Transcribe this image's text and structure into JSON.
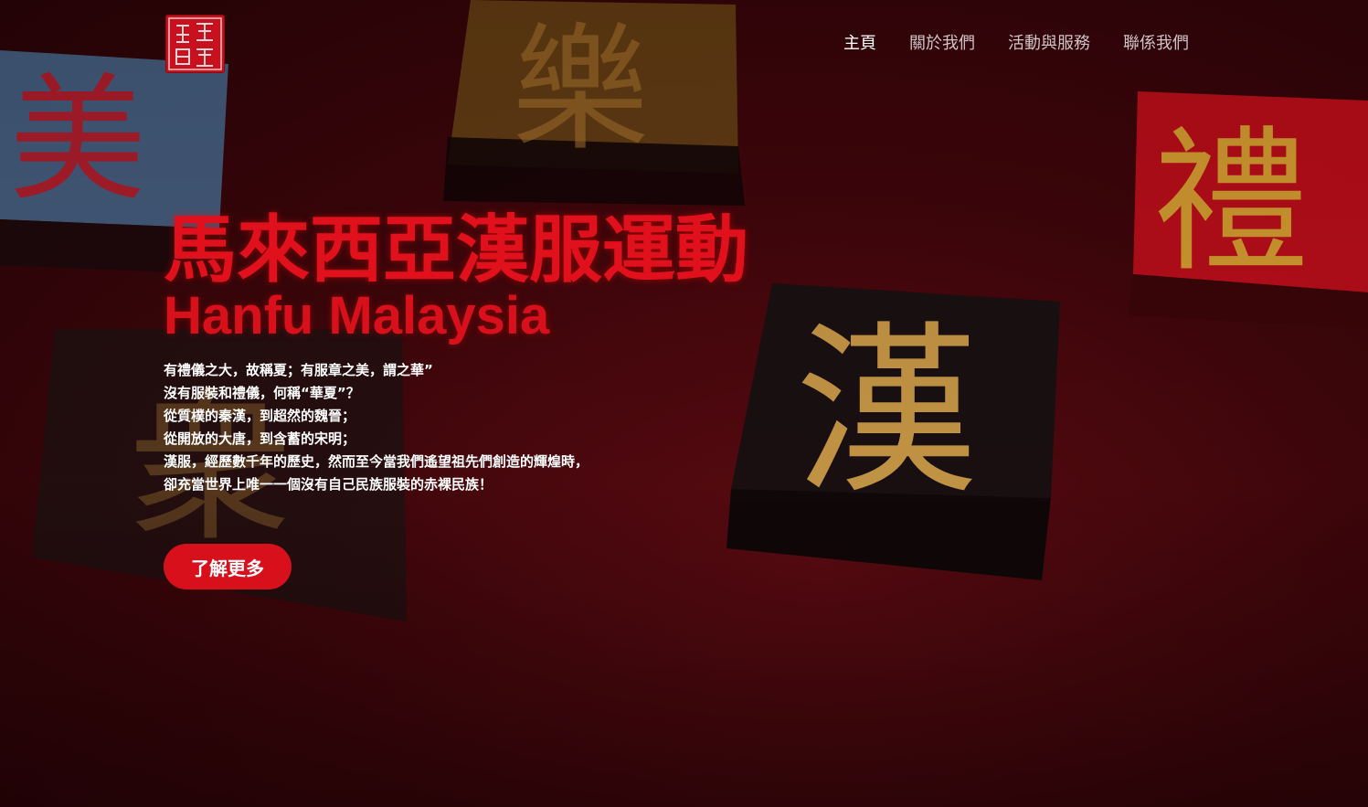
{
  "header": {
    "logo": {
      "icon": "hanfu-seal-logo-icon",
      "color": "#c8101e"
    },
    "nav": [
      {
        "label": "主頁",
        "active": true
      },
      {
        "label": "關於我們",
        "active": false
      },
      {
        "label": "活動與服務",
        "active": false
      },
      {
        "label": "聯係我們",
        "active": false
      }
    ]
  },
  "hero": {
    "background_tiles": [
      "美",
      "樂",
      "禮",
      "漢",
      "衆"
    ],
    "title_zh": "馬來西亞漢服運動",
    "title_en": "Hanfu Malaysia",
    "poem": [
      "有禮儀之大，故稱夏；有服章之美，謂之華”",
      "沒有服裝和禮儀，何稱“華夏”？",
      "從質樸的秦漢，到超然的魏晉；",
      "從開放的大唐，到含蓄的宋明；",
      "漢服，經歷數千年的歷史，然而至今當我們遙望祖先們創造的輝煌時，",
      "卻充當世界上唯一一個沒有自己民族服裝的赤裸民族！"
    ],
    "cta_label": "了解更多"
  },
  "colors": {
    "accent": "#d7101c",
    "background": "#40060b"
  }
}
